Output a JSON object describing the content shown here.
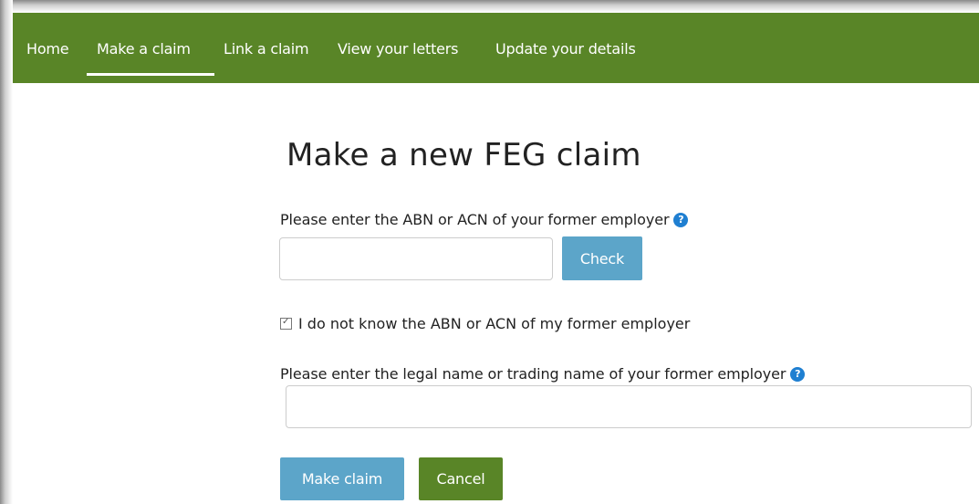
{
  "nav": {
    "items": [
      "Home",
      "Make a claim",
      "Link a claim",
      "View your letters",
      "Update your details"
    ],
    "active": "Make a claim"
  },
  "page": {
    "title": "Make a new FEG claim"
  },
  "abn": {
    "label": "Please enter the ABN or ACN of your former employer",
    "value": "",
    "check_button": "Check"
  },
  "dont_know": {
    "label": "I do not know the ABN or ACN of my former employer",
    "checked": true
  },
  "legal_name": {
    "label": "Please enter the legal name or trading name of your former employer",
    "value": ""
  },
  "actions": {
    "make_claim": "Make claim",
    "cancel": "Cancel"
  },
  "colors": {
    "nav_bg": "#598527",
    "primary_button": "#5ca5c9",
    "cancel_button": "#598527",
    "help_icon": "#1f7fd1"
  },
  "icons": {
    "help": "question-circle-icon",
    "checkbox": "checkbox-checked-icon"
  }
}
